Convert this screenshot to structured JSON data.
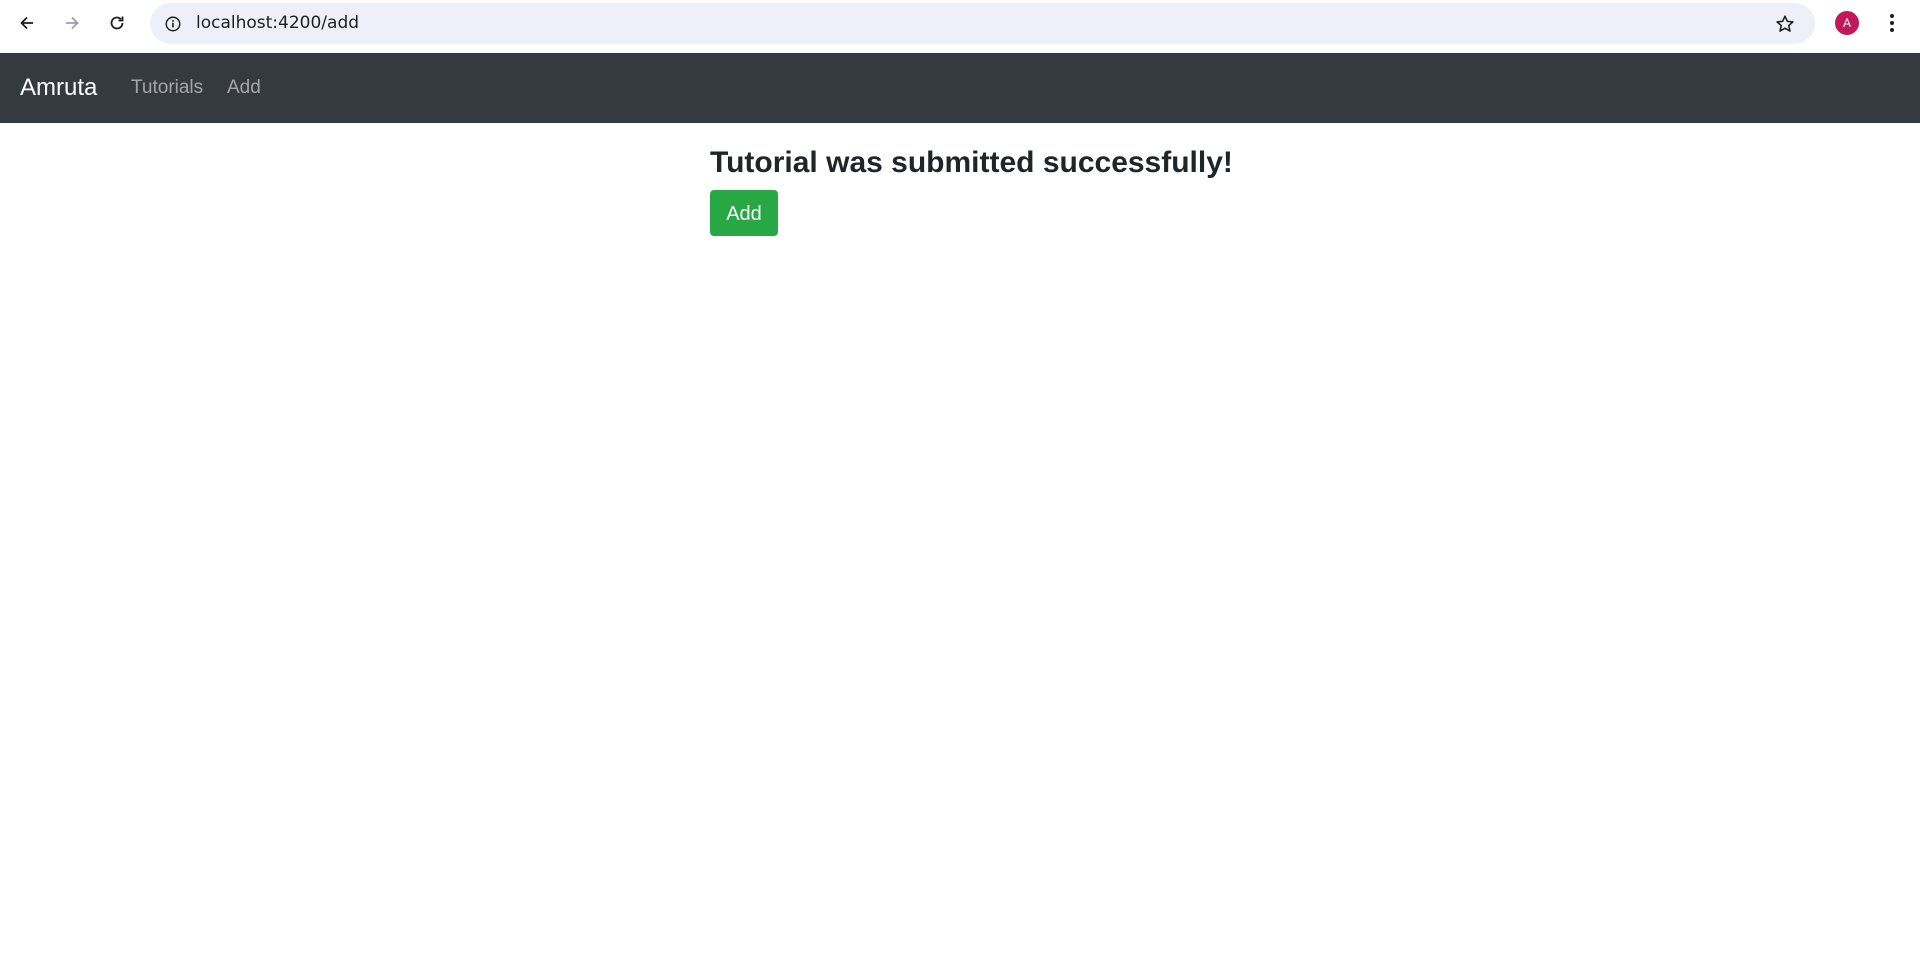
{
  "browser": {
    "url": "localhost:4200/add",
    "profile_initial": "A",
    "profile_color": "#c2185b",
    "icons": {
      "back": "back-arrow-icon",
      "forward": "forward-arrow-icon",
      "reload": "reload-icon",
      "site_info": "info-icon",
      "bookmark": "star-icon",
      "menu": "kebab-menu-icon"
    }
  },
  "navbar": {
    "brand": "Amruta",
    "links": [
      {
        "label": "Tutorials"
      },
      {
        "label": "Add"
      }
    ],
    "background": "#343a40"
  },
  "main": {
    "message": "Tutorial was submitted successfully!",
    "add_button_label": "Add",
    "button_color": "#28a745"
  }
}
